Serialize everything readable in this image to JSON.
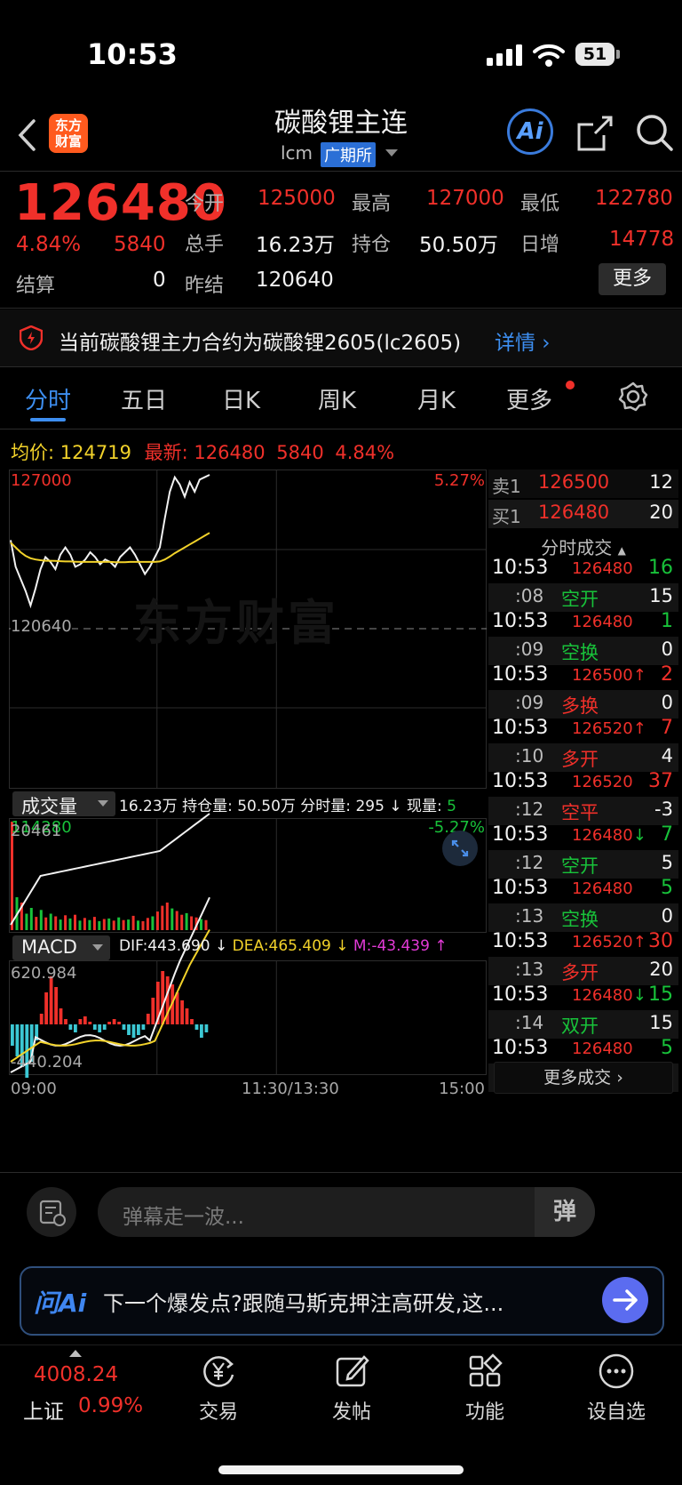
{
  "status_bar": {
    "time": "10:53",
    "battery": "51"
  },
  "header": {
    "logo_text": "东方财富",
    "title": "碳酸锂主连",
    "code": "lcm",
    "exchange": "广期所",
    "ai_label": "Ai"
  },
  "quote": {
    "price": "126480",
    "change_pct": "4.84%",
    "change": "5840",
    "rows": [
      [
        {
          "label": "今开",
          "value": "125000",
          "color": "red"
        },
        {
          "label": "最高",
          "value": "127000",
          "color": "red"
        },
        {
          "label": "最低",
          "value": "122780",
          "color": "red"
        }
      ],
      [
        {
          "label": "总手",
          "value": "16.23万",
          "color": "white"
        },
        {
          "label": "持仓",
          "value": "50.50万",
          "color": "white"
        },
        {
          "label": "日增",
          "value": "14778",
          "color": "red"
        }
      ]
    ],
    "settle_label": "结算",
    "settle_value": "0",
    "prev_settle_label": "昨结",
    "prev_settle_value": "120640",
    "more_label": "更多"
  },
  "notice": {
    "text": "当前碳酸锂主力合约为碳酸锂2605(lc2605)",
    "link": "详情"
  },
  "tabs": [
    "分时",
    "五日",
    "日K",
    "周K",
    "月K",
    "更多"
  ],
  "info_line": {
    "avg_label": "均价:",
    "avg_value": "124719",
    "latest_label": "最新:",
    "latest_value": "126480",
    "latest_change": "5840",
    "latest_pct": "4.84%"
  },
  "chart": {
    "y_top": "127000",
    "y_mid": "120640",
    "y_bottom": "114280",
    "pct_top": "5.27%",
    "pct_bottom": "-5.27%",
    "watermark": "东方财富",
    "x_start": "09:00",
    "x_mid": "11:30/13:30",
    "x_end": "15:00",
    "price_series": [
      124300,
      123200,
      122700,
      122200,
      121600,
      122300,
      123100,
      123600,
      123400,
      123100,
      123700,
      124000,
      123700,
      123200,
      123300,
      123500,
      123800,
      123600,
      123300,
      123500,
      123400,
      123200,
      123600,
      123800,
      124000,
      123700,
      123300,
      122900,
      123200,
      123600,
      124000,
      125200,
      126300,
      126900,
      126600,
      126100,
      126700,
      126300,
      126800,
      126900,
      127000
    ],
    "avg_series": [
      124200,
      124000,
      123800,
      123650,
      123550,
      123500,
      123470,
      123450,
      123450,
      123440,
      123430,
      123420,
      123420,
      123410,
      123400,
      123400,
      123400,
      123400,
      123400,
      123400,
      123400,
      123390,
      123390,
      123390,
      123400,
      123400,
      123400,
      123400,
      123400,
      123400,
      123420,
      123500,
      123620,
      123760,
      123880,
      124000,
      124120,
      124240,
      124360,
      124480,
      124600
    ]
  },
  "volume": {
    "label": "成交量",
    "total": "16.23万",
    "oi_label": "持仓量:",
    "oi_value": "50.50万",
    "tick_label": "分时量:",
    "tick_value": "295",
    "now_label": "现量:",
    "now_value": "5",
    "top_value": "20461",
    "bars": [
      20461,
      6200,
      5200,
      3100,
      4200,
      2500,
      3800,
      2400,
      3100,
      2600,
      2000,
      2800,
      2200,
      2900,
      1800,
      2300,
      1900,
      2500,
      1700,
      2100,
      2200,
      1800,
      2400,
      1900,
      2000,
      2700,
      1800,
      1700,
      2300,
      2600,
      3500,
      4600,
      5200,
      4100,
      3600,
      2900,
      3200,
      2600,
      2400,
      2100,
      1900
    ],
    "bar_colors": [
      "red",
      "green",
      "red",
      "green",
      "green",
      "red",
      "green",
      "red",
      "green",
      "red",
      "green",
      "red",
      "green",
      "red",
      "green",
      "red",
      "green",
      "red",
      "green",
      "red",
      "green",
      "red",
      "green",
      "red",
      "green",
      "red",
      "green",
      "red",
      "red",
      "green",
      "red",
      "red",
      "red",
      "green",
      "red",
      "red",
      "green",
      "red",
      "red",
      "green",
      "red"
    ]
  },
  "macd": {
    "label": "MACD",
    "dif": "DIF:443.690",
    "dea": "DEA:465.409",
    "m": "M:-43.439",
    "top_value": "620.984",
    "bottom_value": "-440.204"
  },
  "order_book": [
    {
      "label": "卖1",
      "price": "126500",
      "qty": "12"
    },
    {
      "label": "买1",
      "price": "126480",
      "qty": "20"
    }
  ],
  "trades_title": "分时成交",
  "trades": [
    {
      "time": "10:53",
      "price": "126480",
      "arrow": "",
      "qty": "16",
      "qty_color": "green",
      "sub": ":08",
      "type": "空开",
      "type_color": "green",
      "sub_qty": "15"
    },
    {
      "time": "10:53",
      "price": "126480",
      "arrow": "",
      "qty": "1",
      "qty_color": "green",
      "sub": ":09",
      "type": "空换",
      "type_color": "green",
      "sub_qty": "0"
    },
    {
      "time": "10:53",
      "price": "126500",
      "arrow": "↑",
      "qty": "2",
      "qty_color": "red",
      "sub": ":09",
      "type": "多换",
      "type_color": "red",
      "sub_qty": "0"
    },
    {
      "time": "10:53",
      "price": "126520",
      "arrow": "↑",
      "qty": "7",
      "qty_color": "red",
      "sub": ":10",
      "type": "多开",
      "type_color": "red",
      "sub_qty": "4"
    },
    {
      "time": "10:53",
      "price": "126520",
      "arrow": "",
      "qty": "37",
      "qty_color": "red",
      "sub": ":12",
      "type": "空平",
      "type_color": "red",
      "sub_qty": "-3"
    },
    {
      "time": "10:53",
      "price": "126480",
      "arrow": "↓",
      "qty": "7",
      "qty_color": "green",
      "sub": ":12",
      "type": "空开",
      "type_color": "green",
      "sub_qty": "5"
    },
    {
      "time": "10:53",
      "price": "126480",
      "arrow": "",
      "qty": "5",
      "qty_color": "green",
      "sub": ":13",
      "type": "空换",
      "type_color": "green",
      "sub_qty": "0"
    },
    {
      "time": "10:53",
      "price": "126520",
      "arrow": "↑",
      "qty": "30",
      "qty_color": "red",
      "sub": ":13",
      "type": "多开",
      "type_color": "red",
      "sub_qty": "20"
    },
    {
      "time": "10:53",
      "price": "126480",
      "arrow": "↓",
      "qty": "15",
      "qty_color": "green",
      "sub": ":14",
      "type": "双开",
      "type_color": "green",
      "sub_qty": "15"
    },
    {
      "time": "10:53",
      "price": "126480",
      "arrow": "",
      "qty": "5",
      "qty_color": "green",
      "sub": ":14",
      "type": "双开",
      "type_color": "green",
      "sub_qty": "5"
    }
  ],
  "more_trades": "更多成交",
  "comment_placeholder": "弹幕走一波...",
  "danmu_icon": "弹",
  "ai_bar": {
    "brand": "问Ai",
    "text": "下一个爆发点?跟随马斯克押注高研发,这..."
  },
  "bottom_nav": {
    "index_value": "4008.24",
    "index_name": "上证",
    "index_pct": "0.99%",
    "items": [
      "交易",
      "发帖",
      "功能",
      "设自选"
    ]
  }
}
